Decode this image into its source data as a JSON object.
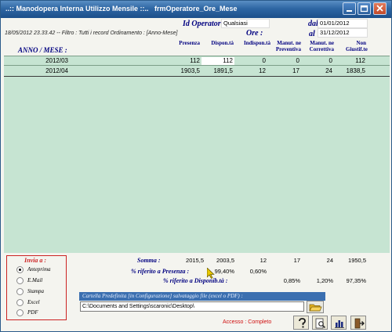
{
  "window": {
    "title": "..:: Manodopera Interna Utilizzo Mensile ::..   frmOperatore_Ore_Mese"
  },
  "header": {
    "operatore_label": "Id Operatore",
    "operatore_value": "Qualsiasi",
    "ore_label": "Ore :",
    "dal_label": "dal",
    "dal_value": "01/01/2012",
    "al_label": "al",
    "al_value": "31/12/2012",
    "info_line": "18/05/2012 23.33.42   --    Filtro : Tutti i record  Ordinamento :  [Anno-Mese]",
    "anno_mese_label": "ANNO / MESE :"
  },
  "columns": {
    "presenza": "Presenza",
    "dispon": "Dispon.tà",
    "indispon": "Indispon.tà",
    "man_prev_1": "Manut. ne",
    "man_prev_2": "Preventiva",
    "man_corr_1": "Manut. ne",
    "man_corr_2": "Correttiva",
    "non_1": "Non",
    "non_2": "Giustif.te"
  },
  "rows": [
    {
      "periodo": "2012/03",
      "presenza": "112",
      "dispon": "112",
      "indispon": "0",
      "prev": "0",
      "corr": "0",
      "non": "112"
    },
    {
      "periodo": "2012/04",
      "presenza": "1903,5",
      "dispon": "1891,5",
      "indispon": "12",
      "prev": "17",
      "corr": "24",
      "non": "1838,5"
    }
  ],
  "invia": {
    "title": "Invia a :",
    "options": [
      "Anteprima",
      "E.Mail",
      "Stampa",
      "Excel",
      "PDF"
    ],
    "selected": "Anteprima"
  },
  "totals": {
    "somma_label": "Somma :",
    "somma": {
      "presenza": "2015,5",
      "dispon": "2003,5",
      "indispon": "12",
      "prev": "17",
      "corr": "24",
      "non": "1950,5"
    },
    "perc_presenza_label": "% riferito a Presenza :",
    "perc_presenza": {
      "dispon": "99,40%",
      "indispon": "0,60%"
    },
    "perc_disp_label": "% riferito a Disponib.tà :",
    "perc_disp": {
      "prev": "0,85%",
      "corr": "1,20%",
      "non": "97,35%"
    }
  },
  "pdf": {
    "header": "Cartella Predefinita [in Configurazione] salvataggio file (excel o PDF) :",
    "path": "C:\\Documents and Settings\\scaronic\\Desktop\\"
  },
  "footer": {
    "accesso": "Accesso : Completo"
  },
  "icons": [
    "help-icon",
    "preview-icon",
    "chart-icon",
    "exit-icon",
    "folder-icon",
    "minimize-icon",
    "maximize-icon",
    "close-icon"
  ]
}
